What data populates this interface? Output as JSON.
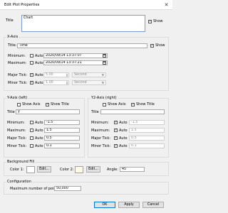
{
  "window": {
    "title": "Edit Plot Properties",
    "close_glyph": "✕"
  },
  "title_section": {
    "label": "Title",
    "value": "Chart",
    "show_label": "Show",
    "show_checked": true
  },
  "x_axis": {
    "group_title": "X-Axis",
    "title_label": "Title:",
    "title_value": "Time",
    "show_label": "Show",
    "show_checked": true,
    "minimum_label": "Minimum:",
    "minimum_auto_label": "Auto",
    "minimum_value": "2020/09/14 13:37:07",
    "maximum_label": "Maximum:",
    "maximum_auto_label": "Auto",
    "maximum_value": "2020/09/14 13:37:21",
    "major_tick_label": "Major Tick:",
    "major_tick_auto_label": "Auto",
    "major_tick_value": "5.00",
    "major_tick_unit": "Second",
    "minor_tick_label": "Minor Tick:",
    "minor_tick_auto_label": "Auto",
    "minor_tick_value": "1.00",
    "minor_tick_unit": "Second"
  },
  "y_axis_left": {
    "group_title": "Y-Axis (left)",
    "show_axis_label": "Show Axis",
    "show_axis_checked": false,
    "show_title_label": "Show Title",
    "show_title_checked": true,
    "title_label": "Title",
    "title_value": "y",
    "minimum_label": "Minimum:",
    "minimum_auto_label": "Auto",
    "minimum_value": "-1.5",
    "maximum_label": "Maximum:",
    "maximum_auto_label": "Auto",
    "maximum_value": "1.5",
    "major_tick_label": "Major Tick:",
    "major_tick_auto_label": "Auto",
    "major_tick_value": "0.5",
    "minor_tick_label": "Minor Tick:",
    "minor_tick_auto_label": "Auto",
    "minor_tick_value": "0.1"
  },
  "y2_axis_right": {
    "group_title": "Y2-Axis (right)",
    "show_axis_label": "Show Axis",
    "show_axis_checked": false,
    "show_title_label": "Show Title",
    "show_title_checked": true,
    "title_label": "Title",
    "title_value": "",
    "minimum_label": "Minimum:",
    "minimum_auto_label": "Auto",
    "minimum_value": "-1.5",
    "maximum_label": "Maximum:",
    "maximum_auto_label": "Auto",
    "maximum_value": "1.5",
    "major_tick_label": "Major Tick:",
    "major_tick_auto_label": "Auto",
    "major_tick_value": "0.5",
    "minor_tick_label": "Minor Tick:",
    "minor_tick_auto_label": "Auto",
    "minor_tick_value": "0.1"
  },
  "background_fill": {
    "group_title": "Background Fill",
    "color1_label": "Color 1:",
    "color1_value": "#ffffff",
    "color1_edit": "Edit...",
    "color2_label": "Color 2:",
    "color2_value": "#fffbe6",
    "color2_edit": "Edit...",
    "angle_label": "Angle:",
    "angle_value": "45"
  },
  "configuration": {
    "group_title": "Configuration",
    "max_points_label": "Maximum number of points:",
    "max_points_value": "50,000"
  },
  "buttons": {
    "ok": "OK",
    "apply": "Apply",
    "cancel": "Cancel"
  }
}
